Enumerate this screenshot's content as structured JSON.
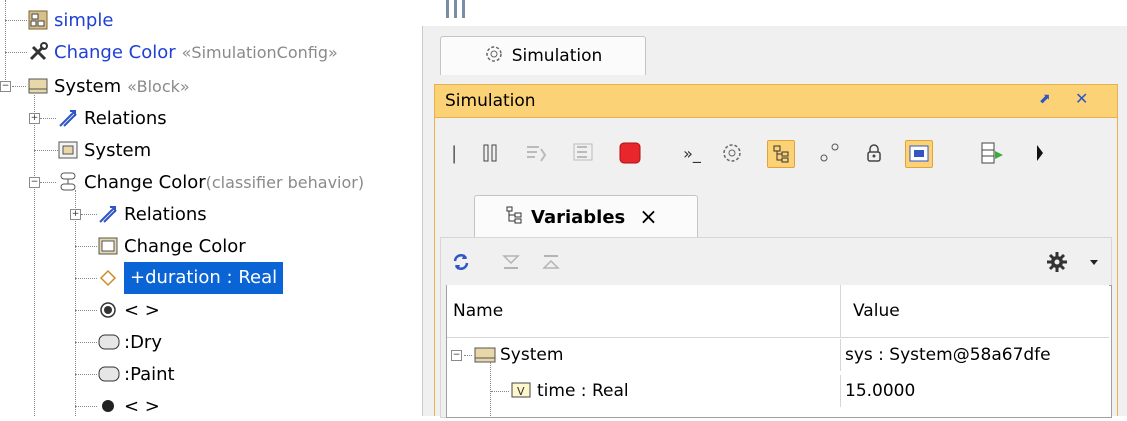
{
  "tree": {
    "items": [
      {
        "label": "simple",
        "stereotype": ""
      },
      {
        "label": "Change Color",
        "stereotype": "«SimulationConfig»"
      },
      {
        "label": "System",
        "stereotype": "«Block»"
      },
      {
        "label": "Relations",
        "stereotype": ""
      },
      {
        "label": "System",
        "stereotype": ""
      },
      {
        "label": "Change Color",
        "stereotype": "(classifier behavior)"
      },
      {
        "label": "Relations",
        "stereotype": ""
      },
      {
        "label": "Change Color",
        "stereotype": ""
      },
      {
        "label": "+duration : Real",
        "stereotype": ""
      },
      {
        "label": "< >",
        "stereotype": ""
      },
      {
        "label": ":Dry",
        "stereotype": ""
      },
      {
        "label": ":Paint",
        "stereotype": ""
      },
      {
        "label": "< >",
        "stereotype": ""
      }
    ]
  },
  "panel": {
    "outer_tab_label": "Simulation",
    "title_bar_label": "Simulation",
    "title_bar_controls": {
      "restore": "⬈",
      "close": "✕"
    },
    "variables_tab_label": "Variables",
    "variables_tab_close": "×",
    "table": {
      "columns": [
        "Name",
        "Value"
      ],
      "rows": [
        {
          "name": "System",
          "value": "sys : System@58a67dfe"
        },
        {
          "name": "time : Real",
          "value": "15.0000"
        }
      ]
    }
  },
  "icons": {
    "toolbar": [
      "step-back-icon",
      "pause-icon",
      "step-into-icon",
      "step-over-icon",
      "stop-icon",
      "console-icon",
      "simulation-icon",
      "variables-icon",
      "breakpoints-icon",
      "lock-icon",
      "animate-icon",
      "export-icon",
      "more-icon"
    ],
    "var_toolbar": [
      "refresh-icon",
      "collapse-icon",
      "expand-icon",
      "gear-icon",
      "chevron-down-icon"
    ]
  },
  "colors": {
    "selection": "#0a64d6",
    "link_blue": "#1f3fd6",
    "title_bar": "#fcd276",
    "stop_red": "#e8262b",
    "refresh_blue": "#2f55c6"
  }
}
